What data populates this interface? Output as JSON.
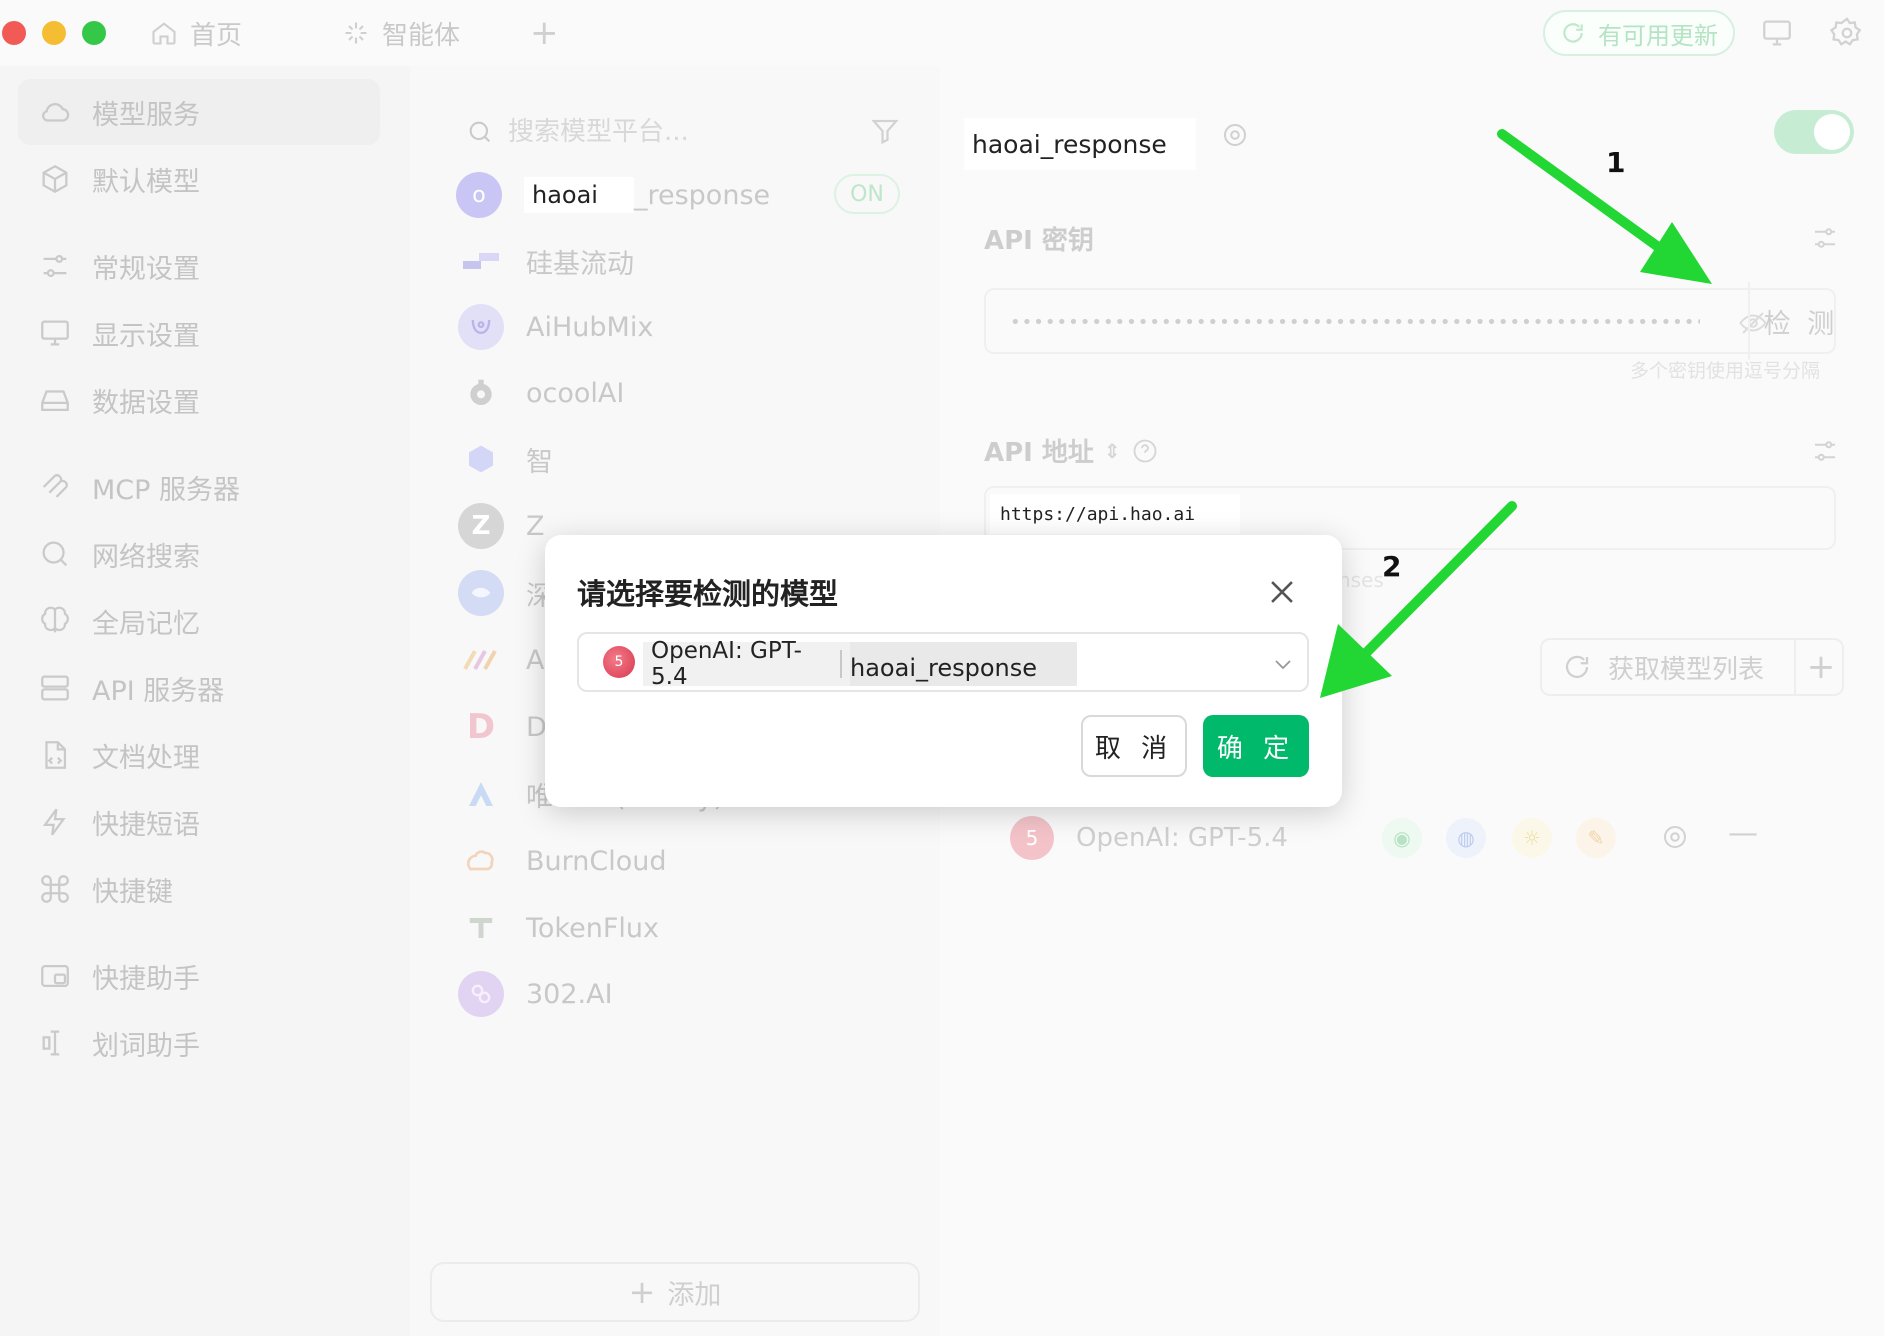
{
  "titlebar": {
    "tabs": [
      {
        "label": "首页",
        "icon": "home-icon"
      },
      {
        "label": "智能体",
        "icon": "sparkle-icon"
      }
    ],
    "update_label": "有可用更新"
  },
  "sidebar": {
    "items": [
      {
        "label": "模型服务",
        "icon": "cloud-icon",
        "active": true
      },
      {
        "label": "默认模型",
        "icon": "cube-icon"
      },
      {
        "label": "常规设置",
        "icon": "sliders-icon"
      },
      {
        "label": "显示设置",
        "icon": "monitor-icon"
      },
      {
        "label": "数据设置",
        "icon": "drive-icon"
      },
      {
        "label": "MCP 服务器",
        "icon": "mcp-icon"
      },
      {
        "label": "网络搜索",
        "icon": "search-icon"
      },
      {
        "label": "全局记忆",
        "icon": "brain-icon"
      },
      {
        "label": "API 服务器",
        "icon": "server-icon"
      },
      {
        "label": "文档处理",
        "icon": "document-icon"
      },
      {
        "label": "快捷短语",
        "icon": "bolt-icon"
      },
      {
        "label": "快捷键",
        "icon": "command-icon"
      },
      {
        "label": "快捷助手",
        "icon": "assistant-window-icon"
      },
      {
        "label": "划词助手",
        "icon": "text-cursor-icon"
      }
    ]
  },
  "providers": {
    "search_placeholder": "搜索模型平台...",
    "active": {
      "name_left": "haoai",
      "name_right": "_response",
      "badge": "ON",
      "avatar": "o"
    },
    "items": [
      {
        "label": "硅基流动"
      },
      {
        "label": "AiHubMix"
      },
      {
        "label": "ocoolAI"
      },
      {
        "label": "智"
      },
      {
        "label": "Z"
      },
      {
        "label": "深"
      },
      {
        "label": "A"
      },
      {
        "label": "DMXAPI"
      },
      {
        "label": "唯一AI (AiOnly)"
      },
      {
        "label": "BurnCloud"
      },
      {
        "label": "TokenFlux"
      },
      {
        "label": "302.AI"
      }
    ],
    "add_label": "添加"
  },
  "settings": {
    "provider_name": "haoai_response",
    "api_key_title": "API 密钥",
    "api_key_masked": "••••••••••••••••••••••••••••••••••••••••••••••••••••••••••••••••••••••",
    "check_label": "检 测",
    "key_hint": "多个密钥使用逗号分隔",
    "api_url_title": "API 地址",
    "api_url": "https://api.hao.ai",
    "url_preview": "nses",
    "fetch_models_label": "获取模型列表",
    "model": {
      "name": "OpenAI: GPT-5.4",
      "logo": "5"
    }
  },
  "dialog": {
    "title": "请选择要检测的模型",
    "selected_model": "OpenAI: GPT-5.4",
    "selected_provider": "haoai_response",
    "selected_logo": "5",
    "cancel_label": "取 消",
    "ok_label": "确 定"
  },
  "annotations": {
    "arrow_color": "#22d633",
    "labels": [
      "1",
      "2"
    ]
  }
}
